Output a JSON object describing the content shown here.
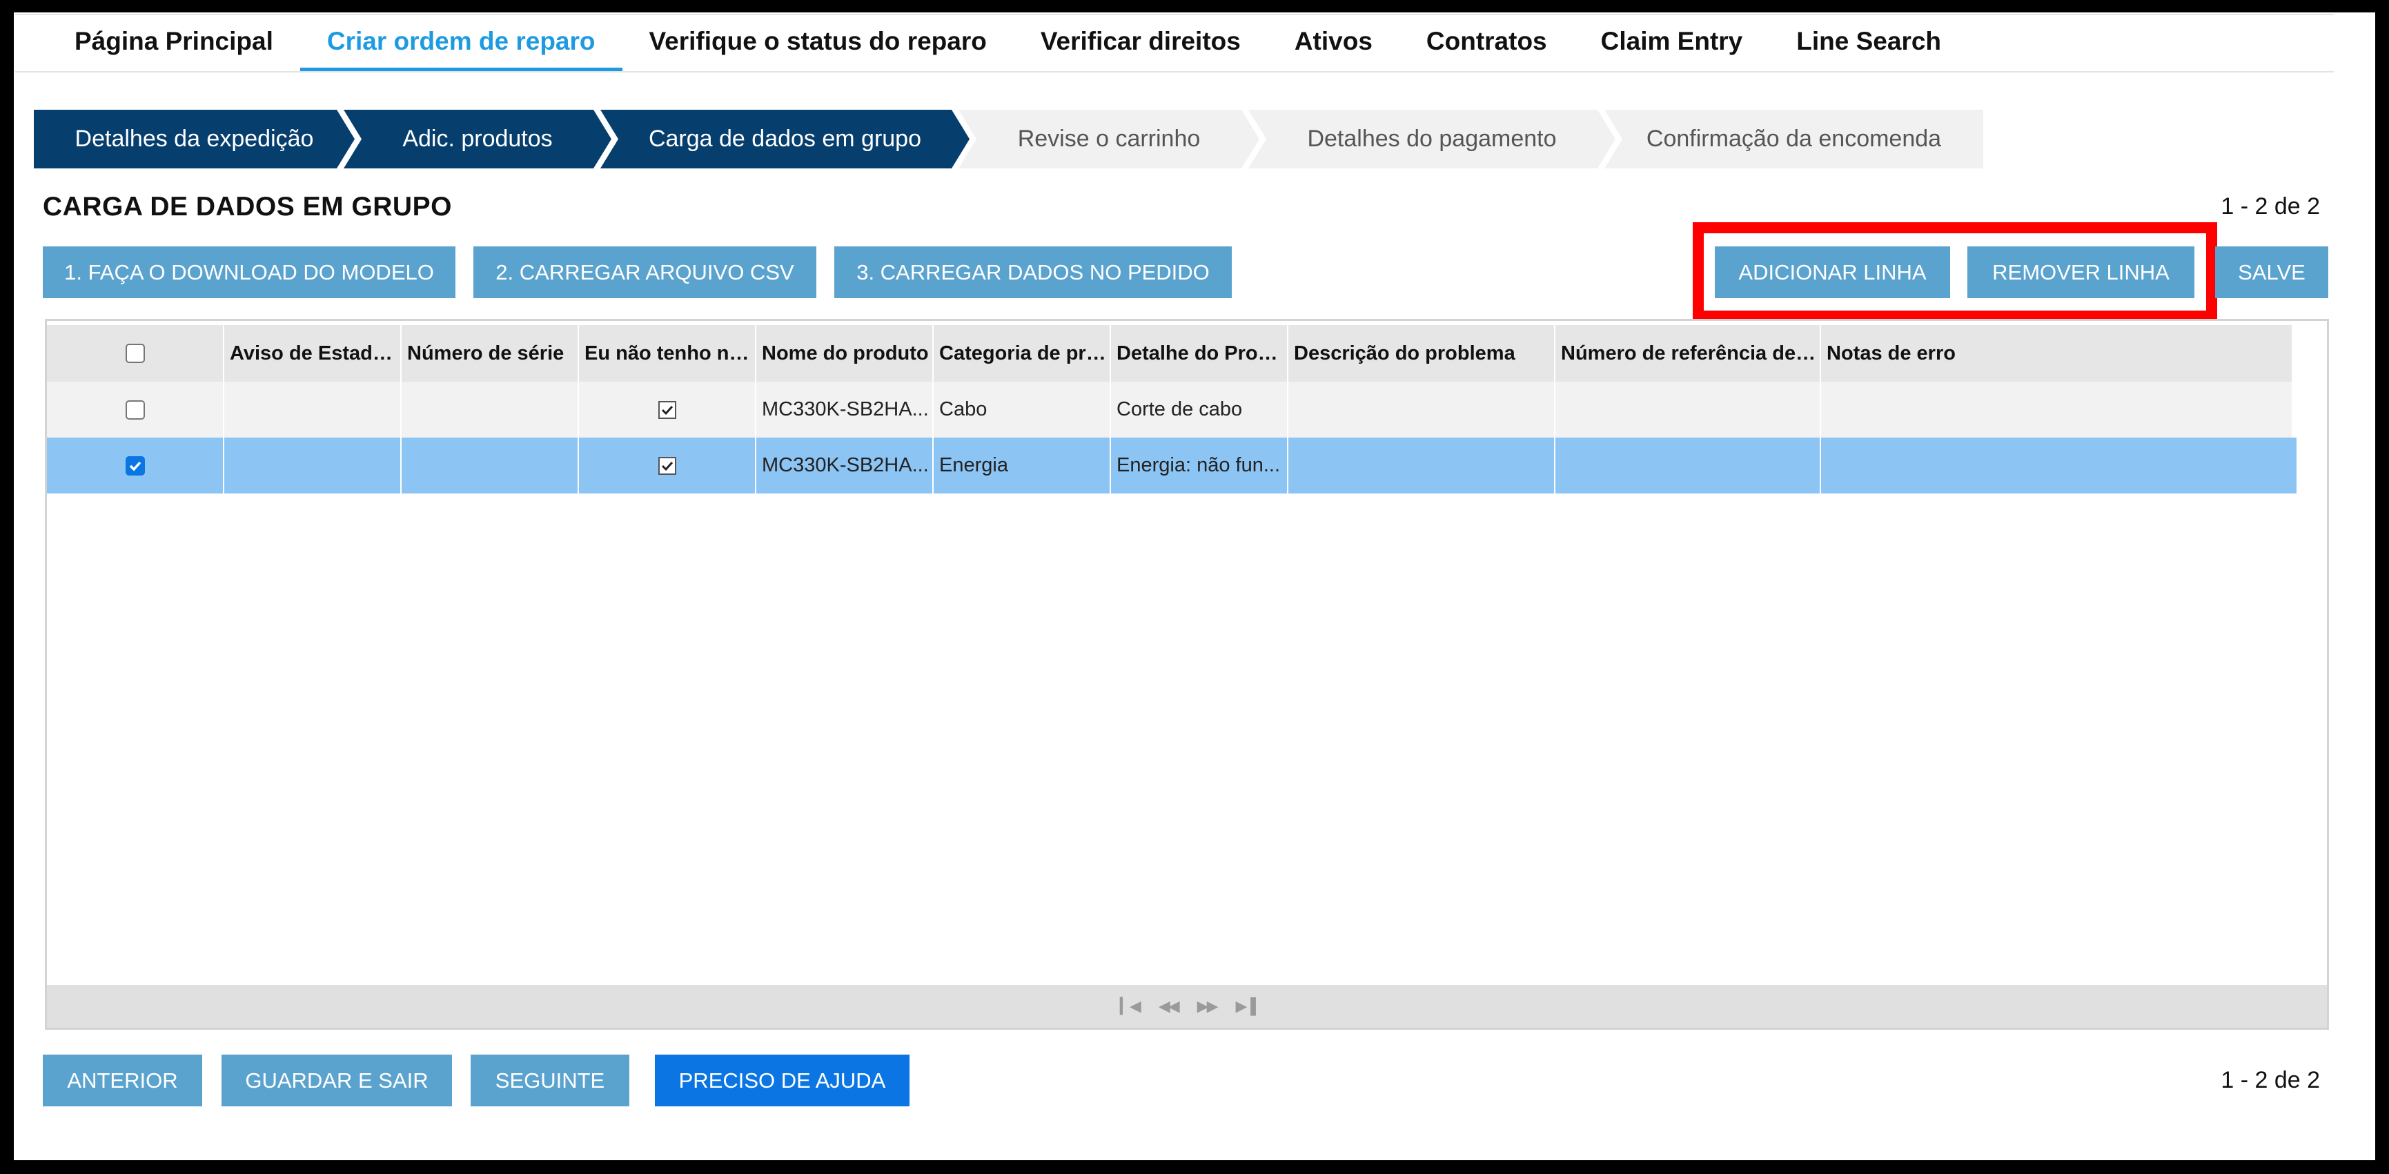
{
  "topnav": {
    "items": [
      {
        "label": "Página Principal"
      },
      {
        "label": "Criar ordem de reparo"
      },
      {
        "label": "Verifique o status do reparo"
      },
      {
        "label": "Verificar direitos"
      },
      {
        "label": "Ativos"
      },
      {
        "label": "Contratos"
      },
      {
        "label": "Claim Entry"
      },
      {
        "label": "Line Search"
      }
    ],
    "active_index": 1
  },
  "steps": [
    {
      "label": "Detalhes da expedição",
      "state": "done"
    },
    {
      "label": "Adic. produtos",
      "state": "done"
    },
    {
      "label": "Carga de dados em grupo",
      "state": "done"
    },
    {
      "label": "Revise o carrinho",
      "state": "todo"
    },
    {
      "label": "Detalhes do pagamento",
      "state": "todo"
    },
    {
      "label": "Confirmação da encomenda",
      "state": "todo"
    }
  ],
  "section": {
    "title": "CARGA DE DADOS EM GRUPO",
    "count_top": "1 - 2 de 2",
    "count_bottom": "1 - 2 de 2"
  },
  "toolbar": {
    "download_template": "1. FAÇA O DOWNLOAD DO MODELO",
    "upload_csv": "2. CARREGAR ARQUIVO CSV",
    "load_into_order": "3. CARREGAR DADOS NO PEDIDO",
    "add_row": "ADICIONAR LINHA",
    "remove_row": "REMOVER LINHA",
    "save": "SALVE"
  },
  "grid": {
    "columns": [
      "Aviso de Estado d",
      "Número de série",
      "Eu não tenho núm",
      "Nome do produto",
      "Categoria de probl",
      "Detalhe do Probler",
      "Descrição do problema",
      "Número de referência de clie",
      "Notas de erro"
    ],
    "rows": [
      {
        "selected": false,
        "status": "",
        "serial": "",
        "no_serial": true,
        "product": "MC330K-SB2HA...",
        "category": "Cabo",
        "detail": "Corte de cabo",
        "description": "",
        "reference": "",
        "errors": ""
      },
      {
        "selected": true,
        "status": "",
        "serial": "",
        "no_serial": true,
        "product": "MC330K-SB2HA...",
        "category": "Energia",
        "detail": "Energia:  não fun...",
        "description": "",
        "reference": "",
        "errors": ""
      }
    ]
  },
  "footer": {
    "previous": "ANTERIOR",
    "save_exit": "GUARDAR E SAIR",
    "next": "SEGUINTE",
    "help": "PRECISO DE AJUDA"
  },
  "colors": {
    "nav_active": "#1e9be0",
    "step_done": "#063e6e",
    "button": "#5ba3cf",
    "button_primary": "#0b76e3",
    "selected_row": "#8cc4f4",
    "highlight": "#ff0000"
  }
}
